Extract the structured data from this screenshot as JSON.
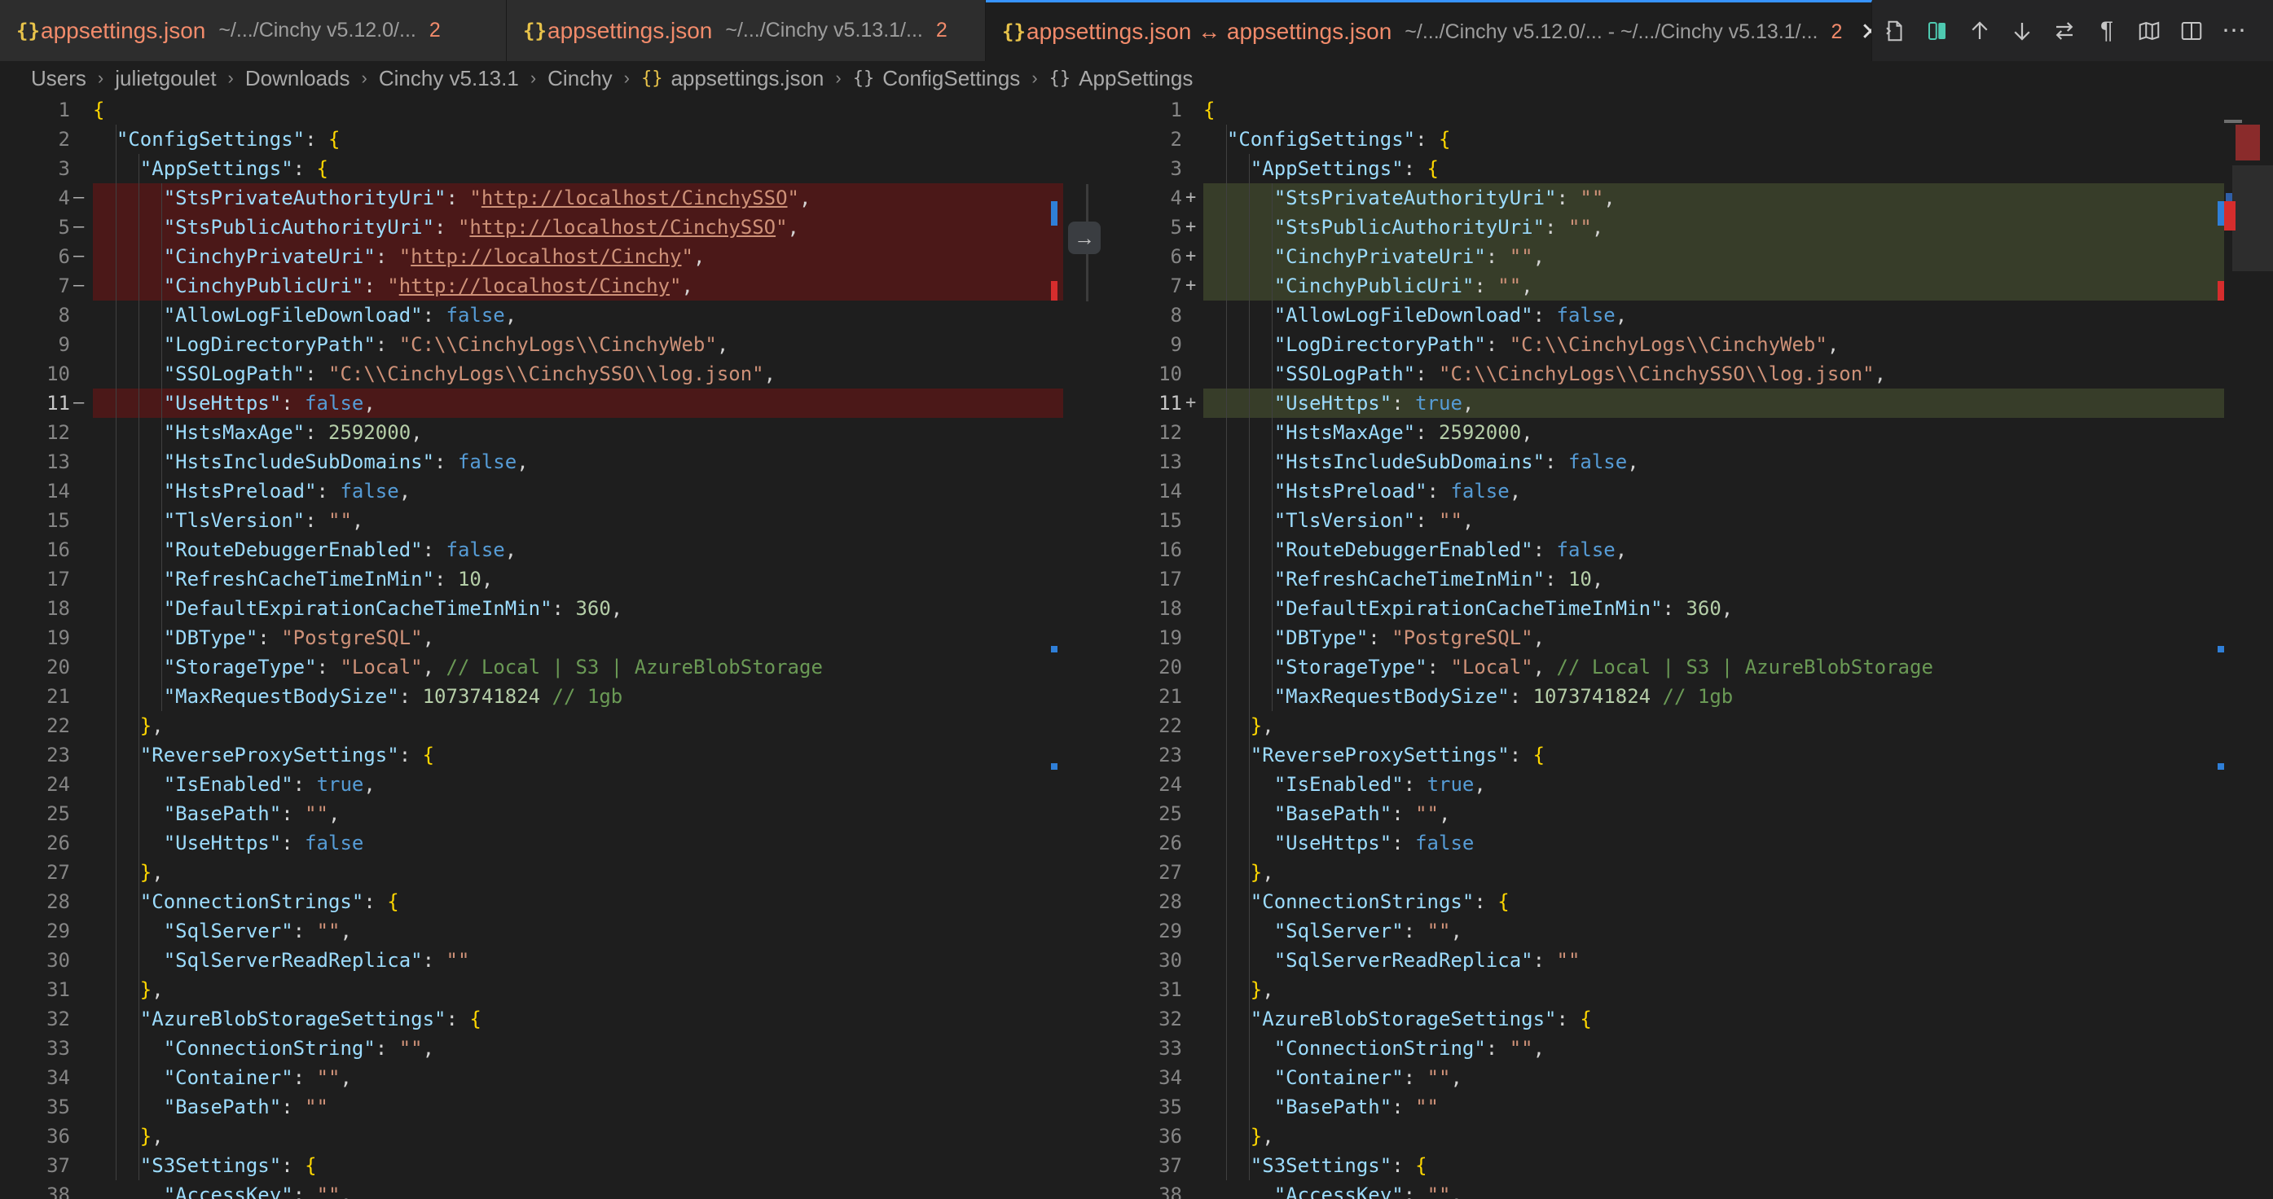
{
  "tabs": [
    {
      "name": "appsettings.json",
      "path": "~/.../Cinchy v5.12.0/...",
      "count": "2"
    },
    {
      "name": "appsettings.json",
      "path": "~/.../Cinchy v5.13.1/...",
      "count": "2"
    },
    {
      "name": "appsettings.json ↔ appsettings.json",
      "path": "~/.../Cinchy v5.12.0/... - ~/.../Cinchy v5.13.1/...",
      "count": "2",
      "close": "✕"
    }
  ],
  "toolbar_icons": [
    "open-file-icon",
    "diff-toggle-icon",
    "previous-change-icon",
    "next-change-icon",
    "swap-icon",
    "whitespace-icon",
    "map-icon",
    "split-editor-icon",
    "more-actions-icon"
  ],
  "breadcrumb": [
    "Users",
    "julietgoulet",
    "Downloads",
    "Cinchy v5.13.1",
    "Cinchy",
    "appsettings.json",
    "ConfigSettings",
    "AppSettings"
  ],
  "colors": {
    "removed": "#4b1818",
    "removed_strong": "#6f1313",
    "inserted": "#373d29",
    "inserted_strong": "#4b5632",
    "accent": "#3794ff"
  },
  "left": {
    "lines": [
      {
        "n": "1",
        "code": "{"
      },
      {
        "n": "2",
        "code": "  \"ConfigSettings\": {"
      },
      {
        "n": "3",
        "code": "    \"AppSettings\": {"
      },
      {
        "n": "4",
        "code": "      \"StsPrivateAuthorityUri\": \"http://localhost/CinchySSO\","
      },
      {
        "n": "5",
        "code": "      \"StsPublicAuthorityUri\": \"http://localhost/CinchySSO\","
      },
      {
        "n": "6",
        "code": "      \"CinchyPrivateUri\": \"http://localhost/Cinchy\","
      },
      {
        "n": "7",
        "code": "      \"CinchyPublicUri\": \"http://localhost/Cinchy\","
      },
      {
        "n": "8",
        "code": "      \"AllowLogFileDownload\": false,"
      },
      {
        "n": "9",
        "code": "      \"LogDirectoryPath\": \"C:\\\\CinchyLogs\\\\CinchyWeb\","
      },
      {
        "n": "10",
        "code": "      \"SSOLogPath\": \"C:\\\\CinchyLogs\\\\CinchySSO\\\\log.json\","
      },
      {
        "n": "11",
        "code": "      \"UseHttps\": false,"
      },
      {
        "n": "12",
        "code": "      \"HstsMaxAge\": 2592000,"
      },
      {
        "n": "13",
        "code": "      \"HstsIncludeSubDomains\": false,"
      },
      {
        "n": "14",
        "code": "      \"HstsPreload\": false,"
      },
      {
        "n": "15",
        "code": "      \"TlsVersion\": \"\","
      },
      {
        "n": "16",
        "code": "      \"RouteDebuggerEnabled\": false,"
      },
      {
        "n": "17",
        "code": "      \"RefreshCacheTimeInMin\": 10,"
      },
      {
        "n": "18",
        "code": "      \"DefaultExpirationCacheTimeInMin\": 360,"
      },
      {
        "n": "19",
        "code": "      \"DBType\": \"PostgreSQL\","
      },
      {
        "n": "20",
        "code": "      \"StorageType\": \"Local\", // Local | S3 | AzureBlobStorage"
      },
      {
        "n": "21",
        "code": "      \"MaxRequestBodySize\": 1073741824 // 1gb"
      },
      {
        "n": "22",
        "code": "    },"
      },
      {
        "n": "23",
        "code": "    \"ReverseProxySettings\": {"
      },
      {
        "n": "24",
        "code": "      \"IsEnabled\": true,"
      },
      {
        "n": "25",
        "code": "      \"BasePath\": \"\","
      },
      {
        "n": "26",
        "code": "      \"UseHttps\": false"
      },
      {
        "n": "27",
        "code": "    },"
      },
      {
        "n": "28",
        "code": "    \"ConnectionStrings\": {"
      },
      {
        "n": "29",
        "code": "      \"SqlServer\": \"\","
      },
      {
        "n": "30",
        "code": "      \"SqlServerReadReplica\": \"\""
      },
      {
        "n": "31",
        "code": "    },"
      },
      {
        "n": "32",
        "code": "    \"AzureBlobStorageSettings\": {"
      },
      {
        "n": "33",
        "code": "      \"ConnectionString\": \"\","
      },
      {
        "n": "34",
        "code": "      \"Container\": \"\","
      },
      {
        "n": "35",
        "code": "      \"BasePath\": \"\""
      },
      {
        "n": "36",
        "code": "    },"
      },
      {
        "n": "37",
        "code": "    \"S3Settings\": {"
      },
      {
        "n": "38",
        "code": "      \"AccessKey\": \"\","
      }
    ]
  },
  "right": {
    "lines": [
      {
        "n": "1",
        "code": "{"
      },
      {
        "n": "2",
        "code": "  \"ConfigSettings\": {"
      },
      {
        "n": "3",
        "code": "    \"AppSettings\": {"
      },
      {
        "n": "4",
        "code": "      \"StsPrivateAuthorityUri\": \"\","
      },
      {
        "n": "5",
        "code": "      \"StsPublicAuthorityUri\": \"\","
      },
      {
        "n": "6",
        "code": "      \"CinchyPrivateUri\": \"\","
      },
      {
        "n": "7",
        "code": "      \"CinchyPublicUri\": \"\","
      },
      {
        "n": "8",
        "code": "      \"AllowLogFileDownload\": false,"
      },
      {
        "n": "9",
        "code": "      \"LogDirectoryPath\": \"C:\\\\CinchyLogs\\\\CinchyWeb\","
      },
      {
        "n": "10",
        "code": "      \"SSOLogPath\": \"C:\\\\CinchyLogs\\\\CinchySSO\\\\log.json\","
      },
      {
        "n": "11",
        "code": "      \"UseHttps\": true,"
      },
      {
        "n": "12",
        "code": "      \"HstsMaxAge\": 2592000,"
      },
      {
        "n": "13",
        "code": "      \"HstsIncludeSubDomains\": false,"
      },
      {
        "n": "14",
        "code": "      \"HstsPreload\": false,"
      },
      {
        "n": "15",
        "code": "      \"TlsVersion\": \"\","
      },
      {
        "n": "16",
        "code": "      \"RouteDebuggerEnabled\": false,"
      },
      {
        "n": "17",
        "code": "      \"RefreshCacheTimeInMin\": 10,"
      },
      {
        "n": "18",
        "code": "      \"DefaultExpirationCacheTimeInMin\": 360,"
      },
      {
        "n": "19",
        "code": "      \"DBType\": \"PostgreSQL\","
      },
      {
        "n": "20",
        "code": "      \"StorageType\": \"Local\", // Local | S3 | AzureBlobStorage"
      },
      {
        "n": "21",
        "code": "      \"MaxRequestBodySize\": 1073741824 // 1gb"
      },
      {
        "n": "22",
        "code": "    },"
      },
      {
        "n": "23",
        "code": "    \"ReverseProxySettings\": {"
      },
      {
        "n": "24",
        "code": "      \"IsEnabled\": true,"
      },
      {
        "n": "25",
        "code": "      \"BasePath\": \"\","
      },
      {
        "n": "26",
        "code": "      \"UseHttps\": false"
      },
      {
        "n": "27",
        "code": "    },"
      },
      {
        "n": "28",
        "code": "    \"ConnectionStrings\": {"
      },
      {
        "n": "29",
        "code": "      \"SqlServer\": \"\","
      },
      {
        "n": "30",
        "code": "      \"SqlServerReadReplica\": \"\""
      },
      {
        "n": "31",
        "code": "    },"
      },
      {
        "n": "32",
        "code": "    \"AzureBlobStorageSettings\": {"
      },
      {
        "n": "33",
        "code": "      \"ConnectionString\": \"\","
      },
      {
        "n": "34",
        "code": "      \"Container\": \"\","
      },
      {
        "n": "35",
        "code": "      \"BasePath\": \"\""
      },
      {
        "n": "36",
        "code": "    },"
      },
      {
        "n": "37",
        "code": "    \"S3Settings\": {"
      },
      {
        "n": "38",
        "code": "      \"AccessKey\": \"\","
      }
    ]
  },
  "diff": {
    "removed_lines": [
      "4",
      "5",
      "6",
      "7",
      "11"
    ],
    "inserted_lines": [
      "4",
      "5",
      "6",
      "7",
      "11"
    ],
    "current_line": "11"
  },
  "revert_label": "→"
}
